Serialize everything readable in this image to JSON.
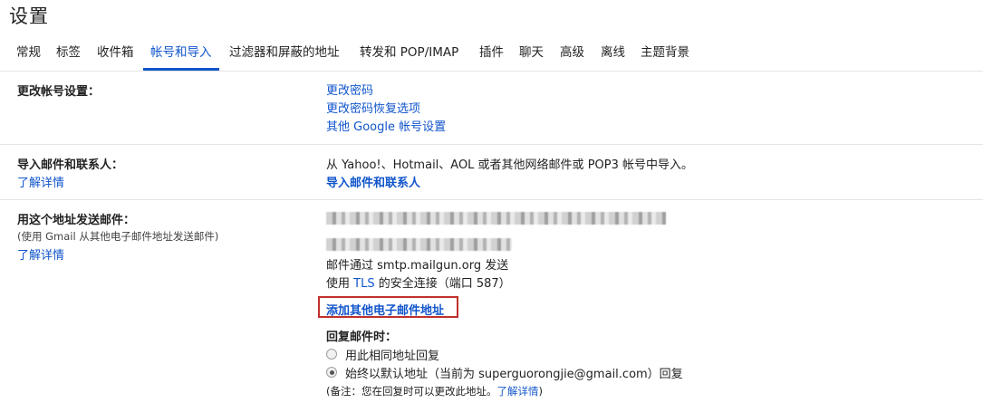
{
  "page": {
    "title": "设置"
  },
  "tabs": [
    {
      "label": "常规"
    },
    {
      "label": "标签"
    },
    {
      "label": "收件箱"
    },
    {
      "label": "帐号和导入",
      "active": true
    },
    {
      "label": "过滤器和屏蔽的地址"
    },
    {
      "label": "转发和 POP/IMAP"
    },
    {
      "label": "插件"
    },
    {
      "label": "聊天"
    },
    {
      "label": "高级"
    },
    {
      "label": "离线"
    },
    {
      "label": "主题背景"
    }
  ],
  "change_account": {
    "label": "更改帐号设置：",
    "links": [
      "更改密码",
      "更改密码恢复选项",
      "其他 Google 帐号设置"
    ]
  },
  "import": {
    "label": "导入邮件和联系人：",
    "learn_more": "了解详情",
    "description": "从 Yahoo!、Hotmail、AOL 或者其他网络邮件或 POP3 帐号中导入。",
    "action": "导入邮件和联系人"
  },
  "send_as": {
    "label": "用这个地址发送邮件：",
    "sub": "(使用 Gmail 从其他电子邮件地址发送邮件)",
    "learn_more": "了解详情",
    "via_prefix": "邮件通过 ",
    "via_server": "smtp.mailgun.org",
    "via_suffix": " 发送",
    "secure_prefix": "使用 ",
    "secure_tls": "TLS",
    "secure_suffix": " 的安全连接（端口 587）",
    "add_address": "添加其他电子邮件地址",
    "reply_heading": "回复邮件时：",
    "reply_options": [
      {
        "label": "用此相同地址回复",
        "checked": false
      },
      {
        "label": "始终以默认地址（当前为 superguorongjie@gmail.com）回复",
        "checked": true
      }
    ],
    "note_prefix": "(备注：您在回复时可以更改此地址。",
    "note_link": "了解详情",
    "note_suffix": ")"
  }
}
